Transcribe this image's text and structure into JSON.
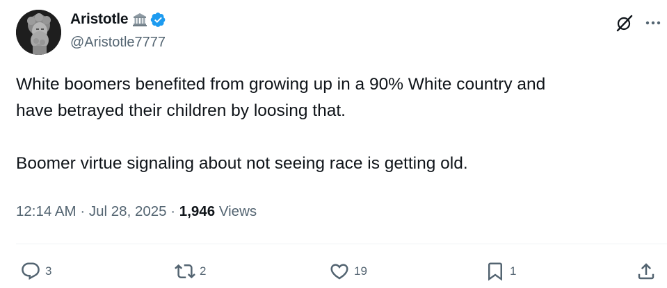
{
  "author": {
    "display_name": "Aristotle",
    "handle": "@Aristotle7777",
    "badge_icon": "classical-building-emoji",
    "verified_icon": "verified-badge-icon",
    "verified_color": "#1d9bf0"
  },
  "tweet": {
    "paragraphs": [
      {
        "lines": [
          "White boomers benefited from growing up in a 90% White country and",
          "have betrayed their children by loosing that."
        ]
      },
      {
        "lines": [
          "Boomer virtue signaling about not seeing race is getting old."
        ]
      }
    ]
  },
  "meta": {
    "time": "12:14 AM",
    "date": "Jul 28, 2025",
    "separator": "·",
    "views_count": "1,946",
    "views_label": "Views"
  },
  "actions": {
    "replies": "3",
    "reposts": "2",
    "likes": "19",
    "bookmarks": "1"
  },
  "colors": {
    "text": "#0f1419",
    "secondary": "#536471",
    "divider": "#eff3f4"
  }
}
